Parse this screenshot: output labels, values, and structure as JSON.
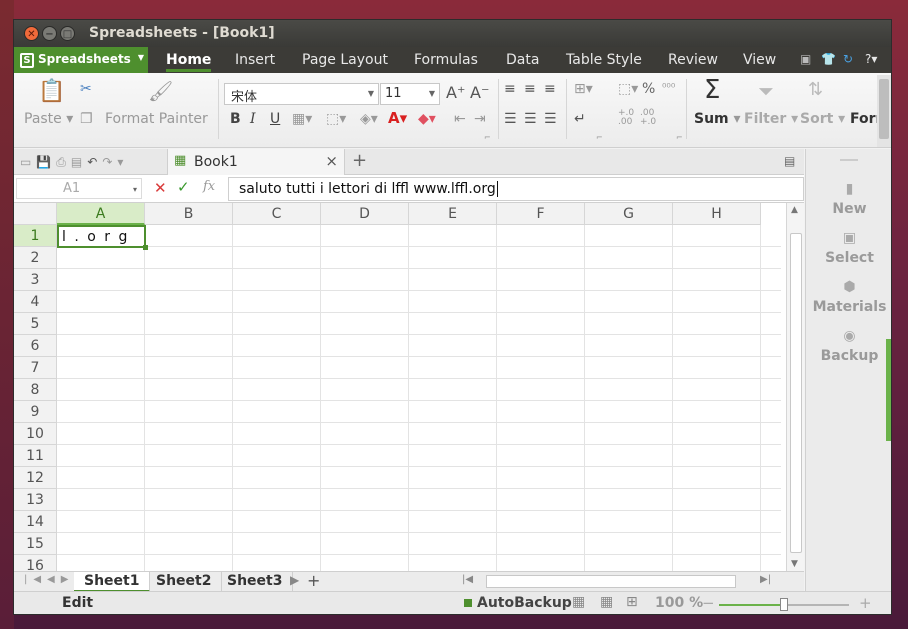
{
  "window": {
    "title": "Spreadsheets - [Book1]"
  },
  "menubar": {
    "app_label": "Spreadsheets",
    "tabs": [
      "Home",
      "Insert",
      "Page Layout",
      "Formulas",
      "Data",
      "Table Style",
      "Review",
      "View"
    ],
    "active_tab": "Home",
    "help_label": "?"
  },
  "ribbon": {
    "paste": "Paste",
    "format_painter": "Format Painter",
    "font_name": "宋体",
    "font_size": "11",
    "bold": "B",
    "italic": "I",
    "underline": "U",
    "percent": "%",
    "sum": "Sum",
    "filter": "Filter",
    "sort": "Sort",
    "format": "Forr",
    "sum_glyph": "Σ"
  },
  "document": {
    "tab_name": "Book1"
  },
  "formula_bar": {
    "cell_ref": "A1",
    "formula": "saluto tutti i lettori di lffl www.lffl.org",
    "fx": "fx"
  },
  "grid": {
    "columns": [
      "A",
      "B",
      "C",
      "D",
      "E",
      "F",
      "G",
      "H"
    ],
    "rows": [
      "1",
      "2",
      "3",
      "4",
      "5",
      "6",
      "7",
      "8",
      "9",
      "10",
      "11",
      "12",
      "13",
      "14",
      "15",
      "16"
    ],
    "selected_column": "A",
    "selected_row": "1",
    "active_cell_text": "l . o r g"
  },
  "sheets": {
    "tabs": [
      "Sheet1",
      "Sheet2",
      "Sheet3"
    ],
    "active": "Sheet1",
    "add": "+"
  },
  "side_pane": {
    "items": [
      "New",
      "Select",
      "Materials",
      "Backup"
    ]
  },
  "status": {
    "mode": "Edit",
    "autobackup": "AutoBackup",
    "zoom": "100 %",
    "zoom_value": 100
  },
  "colors": {
    "accent": "#4e8f2e",
    "titlebar": "#3c3b37",
    "error": "#d93a3a"
  }
}
